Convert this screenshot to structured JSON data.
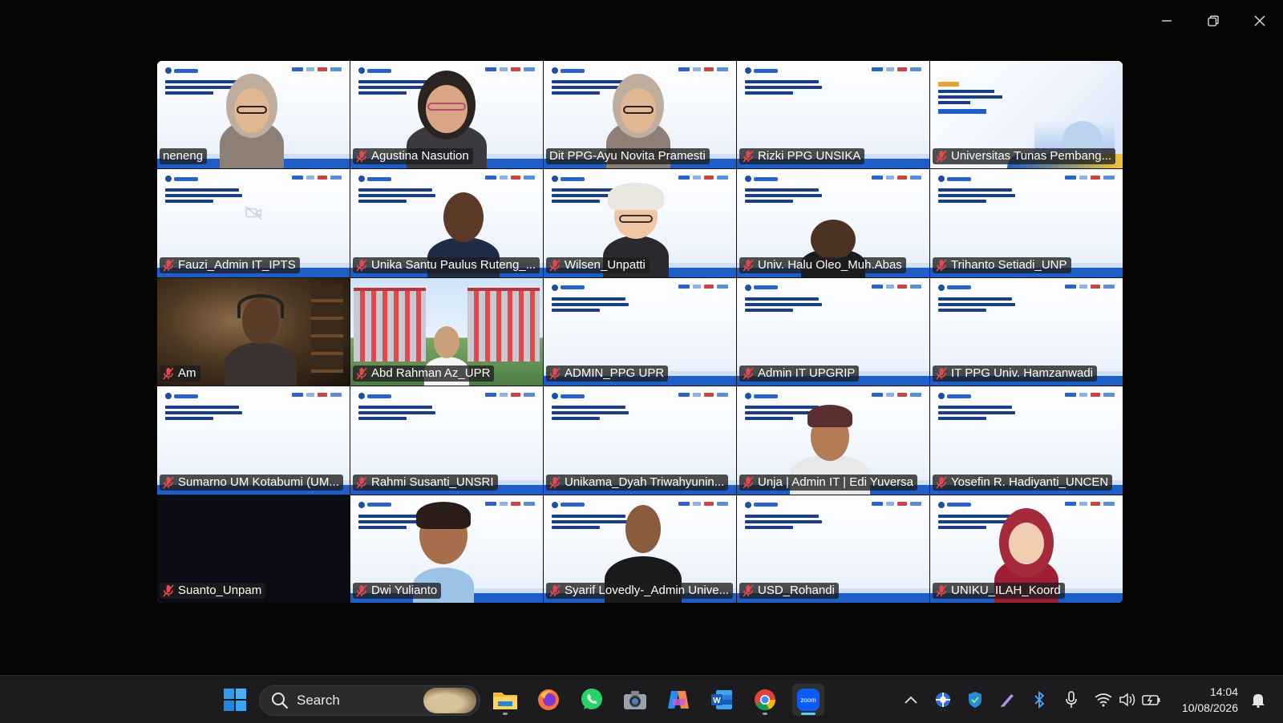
{
  "participants": [
    {
      "name": "neneng",
      "muted": false,
      "bg": "slide",
      "avatar": "hijab-glasses"
    },
    {
      "name": "Agustina Nasution",
      "muted": true,
      "bg": "slide",
      "avatar": "glasses-woman"
    },
    {
      "name": "Dit PPG-Ayu Novita Pramesti",
      "muted": false,
      "bg": "slide",
      "avatar": "hijab-glasses",
      "active_speaker": true
    },
    {
      "name": "Rizki PPG UNSIKA",
      "muted": true,
      "bg": "slide",
      "avatar": "none"
    },
    {
      "name": "Universitas Tunas Pembang...",
      "muted": true,
      "bg": "intro",
      "avatar": "none"
    },
    {
      "name": "Fauzi_Admin IT_IPTS",
      "muted": true,
      "bg": "slide",
      "avatar": "camera-off"
    },
    {
      "name": "Unika Santu Paulus Ruteng_...",
      "muted": true,
      "bg": "slide",
      "avatar": "man-suit"
    },
    {
      "name": "Wilsen_Unpatti",
      "muted": true,
      "bg": "slide",
      "avatar": "avatar-hat"
    },
    {
      "name": "Univ. Halu Oleo_Muh.Abas",
      "muted": true,
      "bg": "slide",
      "avatar": "man-partial"
    },
    {
      "name": "Trihanto Setiadi_UNP",
      "muted": true,
      "bg": "slide",
      "avatar": "none"
    },
    {
      "name": "Am",
      "muted": true,
      "bg": "room",
      "avatar": "man-headset"
    },
    {
      "name": "Abd Rahman Az_UPR",
      "muted": true,
      "bg": "building",
      "avatar": "man-small"
    },
    {
      "name": "ADMIN_PPG UPR",
      "muted": true,
      "bg": "slide",
      "avatar": "none"
    },
    {
      "name": "Admin IT UPGRIP",
      "muted": true,
      "bg": "slide",
      "avatar": "none"
    },
    {
      "name": "IT PPG Univ. Hamzanwadi",
      "muted": true,
      "bg": "slide",
      "avatar": "none"
    },
    {
      "name": "Sumarno UM Kotabumi (UM...",
      "muted": true,
      "bg": "slide",
      "avatar": "none"
    },
    {
      "name": "Rahmi Susanti_UNSRI",
      "muted": true,
      "bg": "slide",
      "avatar": "none"
    },
    {
      "name": "Unikama_Dyah Triwahyunin...",
      "muted": true,
      "bg": "slide",
      "avatar": "none"
    },
    {
      "name": "Unja | Admin IT | Edi Yuversa",
      "muted": true,
      "bg": "slide",
      "avatar": "man-cap"
    },
    {
      "name": "Yosefin R. Hadiyanti_UNCEN",
      "muted": true,
      "bg": "slide",
      "avatar": "none"
    },
    {
      "name": "Suanto_Unpam",
      "muted": true,
      "bg": "dark",
      "avatar": "none"
    },
    {
      "name": "Dwi Yulianto",
      "muted": true,
      "bg": "slide",
      "avatar": "avatar-boy"
    },
    {
      "name": "Syarif Lovedly-_Admin Unive...",
      "muted": true,
      "bg": "slide",
      "avatar": "man-dark"
    },
    {
      "name": "USD_Rohandi",
      "muted": true,
      "bg": "slide",
      "avatar": "none"
    },
    {
      "name": "UNIKU_ILAH_Koord",
      "muted": true,
      "bg": "slide",
      "avatar": "avatar-hijab"
    }
  ],
  "window_controls": {
    "minimize": "minimize-icon",
    "maximize": "restore-icon",
    "close": "close-icon"
  },
  "taskbar": {
    "search_label": "Search",
    "apps": [
      "start-icon",
      "file-explorer-icon",
      "firefox-icon",
      "whatsapp-icon",
      "camera-icon",
      "copilot-icon",
      "word-icon",
      "chrome-icon",
      "zoom-icon"
    ],
    "active_app": "zoom-icon",
    "zoom_label": "zoom",
    "tray": [
      "chevron-up-icon",
      "app-tray-icon",
      "security-shield-icon",
      "pen-icon",
      "bluetooth-icon",
      "microphone-icon",
      "wifi-icon",
      "volume-icon",
      "battery-icon"
    ],
    "time": "14:04",
    "date": "10/08/2026"
  },
  "colors": {
    "active_speaker_border": "#2fe08c",
    "mic_off_red": "#e5484d",
    "zoom_blue": "#0b5cff",
    "taskbar": "#1c1c1e"
  }
}
